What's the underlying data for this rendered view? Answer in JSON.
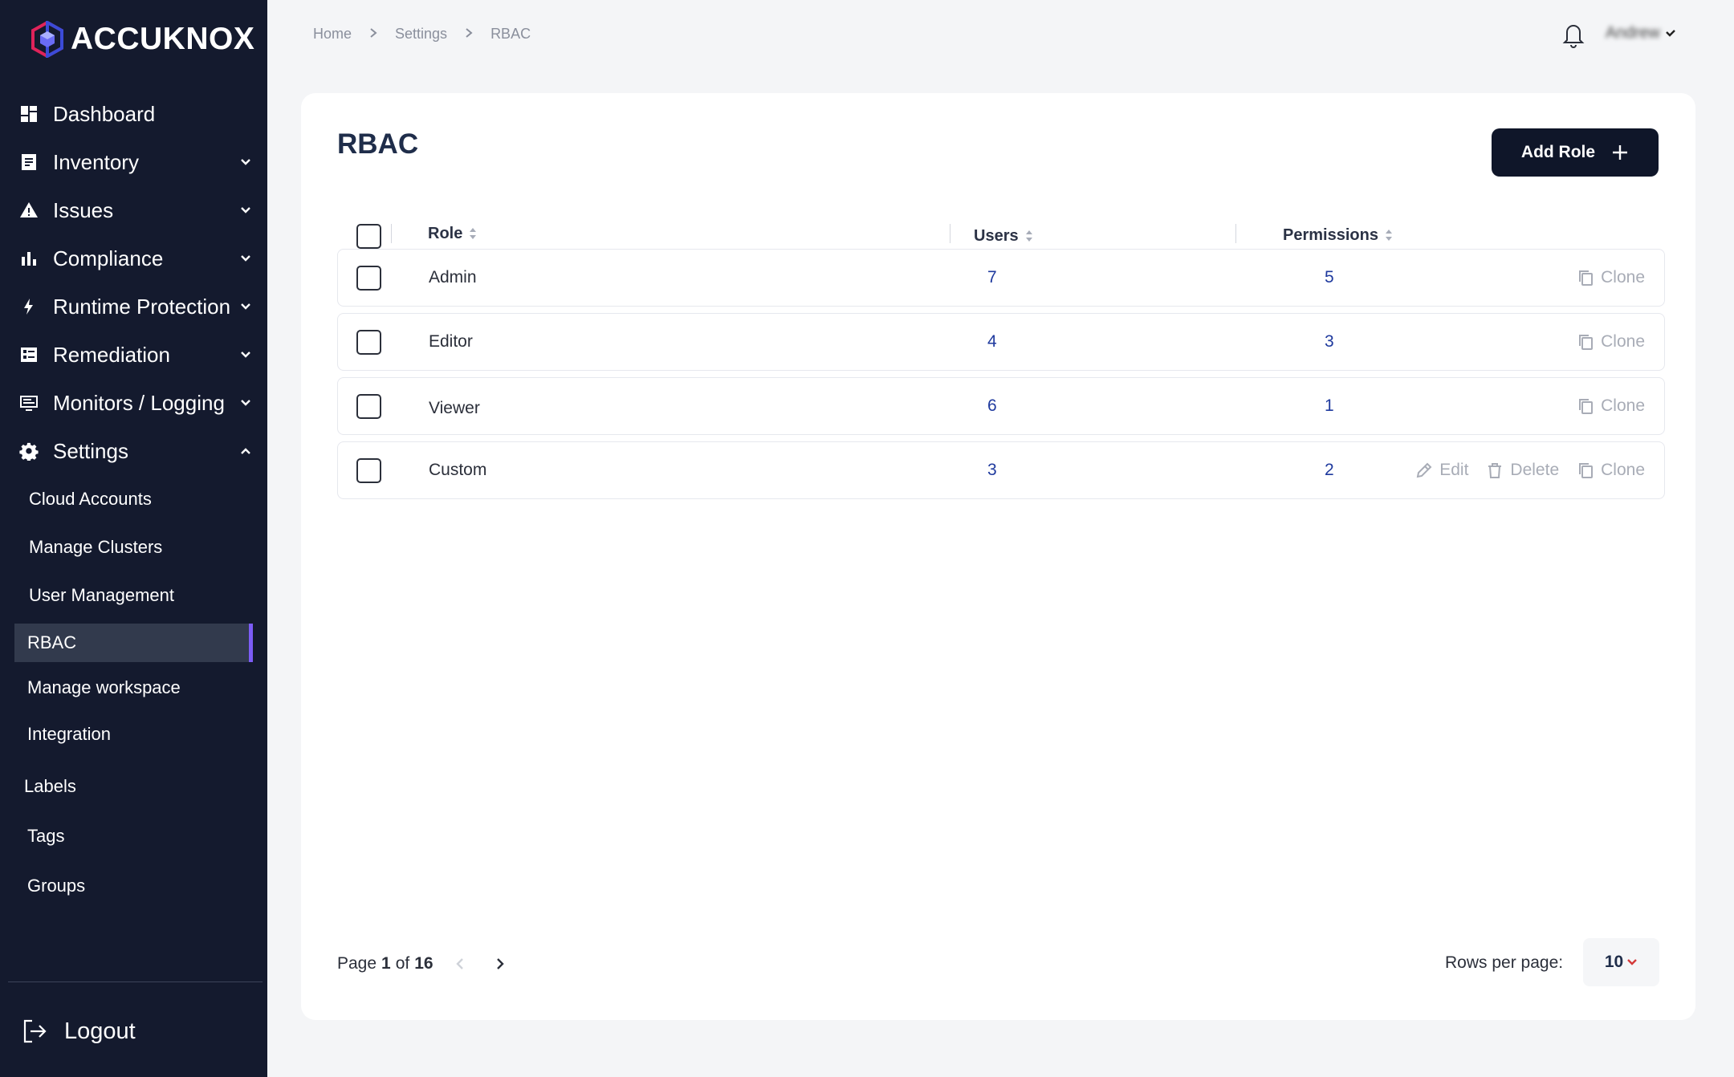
{
  "app": {
    "brand": "ACCUKNOX"
  },
  "sidebar": {
    "items": [
      {
        "label": "Dashboard",
        "icon": "dashboard-icon"
      },
      {
        "label": "Inventory",
        "icon": "inventory-icon"
      },
      {
        "label": "Issues",
        "icon": "warning-icon"
      },
      {
        "label": "Compliance",
        "icon": "bar-chart-icon"
      },
      {
        "label": "Runtime Protection",
        "icon": "bolt-icon"
      },
      {
        "label": "Remediation",
        "icon": "remediation-icon"
      },
      {
        "label": "Monitors / Logging",
        "icon": "monitor-icon"
      },
      {
        "label": "Settings",
        "icon": "gear-icon"
      }
    ],
    "settings_children": [
      {
        "label": "Cloud Accounts"
      },
      {
        "label": "Manage Clusters"
      },
      {
        "label": "User Management"
      },
      {
        "label": "RBAC",
        "active": true
      },
      {
        "label": "Manage workspace"
      },
      {
        "label": "Integration"
      },
      {
        "label": "Labels"
      },
      {
        "label": "Tags"
      },
      {
        "label": "Groups"
      }
    ],
    "logout_label": "Logout"
  },
  "breadcrumb": [
    "Home",
    "Settings",
    "RBAC"
  ],
  "user": {
    "name": "Andrew"
  },
  "main": {
    "title": "RBAC",
    "add_button_label": "Add Role",
    "columns": {
      "role": "Role",
      "users": "Users",
      "permissions": "Permissions"
    },
    "rows": [
      {
        "role": "Admin",
        "users": "7",
        "permissions": "5",
        "actions": [
          "Clone"
        ]
      },
      {
        "role": "Editor",
        "users": "4",
        "permissions": "3",
        "actions": [
          "Clone"
        ]
      },
      {
        "role": "Viewer",
        "users": "6",
        "permissions": "1",
        "actions": [
          "Clone"
        ]
      },
      {
        "role": "Custom",
        "users": "3",
        "permissions": "2",
        "actions": [
          "Edit",
          "Delete",
          "Clone"
        ]
      }
    ],
    "action_labels": {
      "edit": "Edit",
      "delete": "Delete",
      "clone": "Clone"
    }
  },
  "pagination": {
    "page_prefix": "Page",
    "current": "1",
    "of": "of",
    "total": "16",
    "rows_per_page_label": "Rows per page:",
    "rows_per_page": "10"
  },
  "colors": {
    "sidebar_bg": "#141a2e",
    "active_accent": "#7c5cf6",
    "primary_button": "#0f1629",
    "link_blue": "#1f3a9e"
  }
}
